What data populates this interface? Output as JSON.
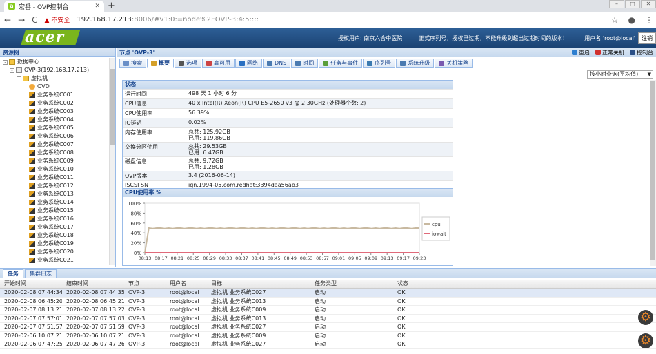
{
  "browser": {
    "tab_title": "宏番 - OVP控制台",
    "not_secure": "不安全",
    "url_host": "192.168.17.213",
    "url_rest": ":8006/#v1:0:=node%2FOVP-3:4:5::::"
  },
  "banner": {
    "logo": "acer",
    "license_user": "授权用户: 南京六合中医院",
    "serial": "正式序列号，授权已过期，不能升级到超出过期时间的版本！",
    "user": "用户名:'root@local'",
    "logout": "注销"
  },
  "tree": {
    "header": "资源树",
    "datacenter": "数据中心",
    "node": "OVP-3(192.168.17.213)",
    "vm_folder": "虚拟机",
    "ovd": "OVD",
    "vms": [
      "业务系统C001",
      "业务系统C002",
      "业务系统C003",
      "业务系统C004",
      "业务系统C005",
      "业务系统C006",
      "业务系统C007",
      "业务系统C008",
      "业务系统C009",
      "业务系统C010",
      "业务系统C011",
      "业务系统C012",
      "业务系统C013",
      "业务系统C014",
      "业务系统C015",
      "业务系统C016",
      "业务系统C017",
      "业务系统C018",
      "业务系统C019",
      "业务系统C020",
      "业务系统C021"
    ]
  },
  "node_header": {
    "title": "节点 'OVP-3'",
    "restart": "重启",
    "shutdown": "正常关机",
    "console": "控制台"
  },
  "tabs": [
    "搜索",
    "概要",
    "选项",
    "高可用",
    "网络",
    "DNS",
    "时间",
    "任务与事件",
    "序列号",
    "系统升级",
    "关机策略"
  ],
  "active_tab": "概要",
  "query_select": "按小时查询(平均值)",
  "status": {
    "header": "状态",
    "rows": [
      {
        "k": "运行时间",
        "v": "498 天 1 小时 6 分"
      },
      {
        "k": "CPU信息",
        "v": "40 x Intel(R) Xeon(R) CPU E5-2650 v3 @ 2.30GHz (处理器个数: 2)"
      },
      {
        "k": "CPU使用率",
        "v": "56.39%"
      },
      {
        "k": "IO延迟",
        "v": "0.02%"
      },
      {
        "k": "内存使用率",
        "v": "总共: 125.92GB",
        "v2": "已用: 119.86GB"
      },
      {
        "k": "交换分区使用",
        "v": "总共: 29.53GB",
        "v2": "已用: 6.47GB"
      },
      {
        "k": "磁盘信息",
        "v": "总共: 9.72GB",
        "v2": "已用: 1.28GB"
      },
      {
        "k": "OVP版本",
        "v": "3.4 (2016-06-14)"
      },
      {
        "k": "ISCSI SN",
        "v": "iqn.1994-05.com.redhat:3394daa56ab3"
      }
    ]
  },
  "chart_data": {
    "type": "line",
    "title": "CPU使用率 %",
    "x": [
      "08:13",
      "08:17",
      "08:21",
      "08:25",
      "08:29",
      "08:33",
      "08:37",
      "08:41",
      "08:45",
      "08:49",
      "08:53",
      "08:57",
      "09:01",
      "09:05",
      "09:09",
      "09:13",
      "09:17",
      "09:23"
    ],
    "y_ticks": [
      "0%",
      "20%",
      "40%",
      "60%",
      "80%",
      "100%"
    ],
    "ylim": [
      0,
      100
    ],
    "series": [
      {
        "name": "cpu",
        "color": "#c8b9a0",
        "values": [
          0,
          50,
          49,
          50,
          50,
          49,
          50,
          49,
          50,
          50,
          49,
          50,
          50,
          49,
          50,
          49,
          50,
          50,
          49,
          50,
          49,
          50,
          50,
          49,
          50,
          50,
          49,
          50,
          49,
          50,
          50,
          49,
          50,
          49,
          50,
          50,
          49,
          50,
          50,
          49,
          50,
          49,
          50,
          50,
          49,
          50,
          49,
          50,
          50,
          49,
          50,
          49,
          50,
          50,
          49,
          50,
          50,
          49,
          50,
          49,
          50,
          50,
          49,
          50,
          49,
          50,
          50,
          49,
          50,
          50
        ]
      },
      {
        "name": "iowait",
        "color": "#e06a7a",
        "values": [
          0,
          0,
          0,
          0,
          0,
          0,
          0,
          0,
          0,
          0,
          0,
          0,
          0,
          0,
          0,
          0,
          0,
          0,
          0,
          0,
          0,
          0,
          0,
          0,
          0,
          0,
          0,
          0,
          0,
          0,
          0,
          0,
          0,
          0,
          0,
          0,
          0,
          0,
          0,
          0,
          0,
          0,
          0,
          0,
          0,
          0,
          0,
          0,
          0,
          0,
          0,
          0,
          0,
          0,
          0,
          0,
          0,
          0,
          0,
          0,
          0,
          0,
          0,
          0,
          0,
          0,
          0,
          0,
          0,
          0
        ]
      }
    ],
    "legend_position": "right"
  },
  "bottom": {
    "tabs": [
      "任务",
      "集群日志"
    ],
    "columns": [
      "开始时间",
      "结束时间",
      "节点",
      "用户名",
      "目标",
      "任务类型",
      "状态"
    ],
    "rows": [
      [
        "2020-02-08 07:44:34",
        "2020-02-08 07:44:35",
        "OVP-3",
        "root@local",
        "虚拟机 业务系统C027",
        "启动",
        "OK"
      ],
      [
        "2020-02-08 06:45:20",
        "2020-02-08 06:45:21",
        "OVP-3",
        "root@local",
        "虚拟机 业务系统C013",
        "启动",
        "OK"
      ],
      [
        "2020-02-07 08:13:21",
        "2020-02-07 08:13:22",
        "OVP-3",
        "root@local",
        "虚拟机 业务系统C009",
        "启动",
        "OK"
      ],
      [
        "2020-02-07 07:57:01",
        "2020-02-07 07:57:03",
        "OVP-3",
        "root@local",
        "虚拟机 业务系统C013",
        "启动",
        "OK"
      ],
      [
        "2020-02-07 07:51:57",
        "2020-02-07 07:51:59",
        "OVP-3",
        "root@local",
        "虚拟机 业务系统C027",
        "启动",
        "OK"
      ],
      [
        "2020-02-06 10:07:21",
        "2020-02-06 10:07:21",
        "OVP-3",
        "root@local",
        "虚拟机 业务系统C009",
        "启动",
        "OK"
      ],
      [
        "2020-02-06 07:47:25",
        "2020-02-06 07:47:26",
        "OVP-3",
        "root@local",
        "虚拟机 业务系统C027",
        "启动",
        "OK"
      ]
    ]
  }
}
